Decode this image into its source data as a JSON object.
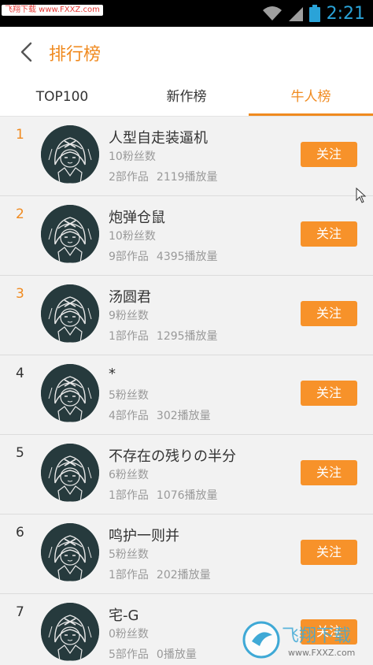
{
  "status_bar": {
    "watermark_text": "飞翔下载 www.FXXZ.com",
    "time": "2:21",
    "icons": [
      "wifi-icon",
      "signal-icon",
      "battery-icon"
    ]
  },
  "header": {
    "title": "排行榜",
    "back_icon": "chevron-left-icon"
  },
  "tabs": [
    {
      "label": "TOP100"
    },
    {
      "label": "新作榜"
    },
    {
      "label": "牛人榜",
      "active": true
    }
  ],
  "colors": {
    "accent": "#f08a1f",
    "button": "#f7922a",
    "avatar_bg": "#263a3d"
  },
  "users": [
    {
      "rank": "1",
      "name": "人型自走装逼机",
      "fans": "10粉丝数",
      "works": "2部作品",
      "plays": "2119播放量",
      "follow": "关注"
    },
    {
      "rank": "2",
      "name": "炮弹仓鼠",
      "fans": "10粉丝数",
      "works": "9部作品",
      "plays": "4395播放量",
      "follow": "关注"
    },
    {
      "rank": "3",
      "name": "汤圆君",
      "fans": "9粉丝数",
      "works": "1部作品",
      "plays": "1295播放量",
      "follow": "关注"
    },
    {
      "rank": "4",
      "name": "*",
      "fans": "5粉丝数",
      "works": "4部作品",
      "plays": "302播放量",
      "follow": "关注"
    },
    {
      "rank": "5",
      "name": "不存在の残りの半分",
      "fans": "6粉丝数",
      "works": "1部作品",
      "plays": "1076播放量",
      "follow": "关注"
    },
    {
      "rank": "6",
      "name": "鸣护一则并",
      "fans": "5粉丝数",
      "works": "1部作品",
      "plays": "202播放量",
      "follow": "关注"
    },
    {
      "rank": "7",
      "name": "宅-G",
      "fans": "0粉丝数",
      "works": "5部作品",
      "plays": "0播放量",
      "follow": "关注"
    }
  ],
  "bottom_watermark": {
    "cn": "飞翔下载",
    "url": "www.FXXZ.com"
  }
}
